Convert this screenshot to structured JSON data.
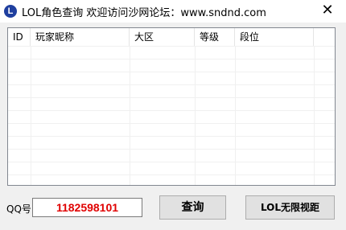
{
  "window": {
    "title": "LOL角色查询  欢迎访问沙网论坛：www.sndnd.com",
    "app_icon_glyph": "L",
    "close_glyph": "✕"
  },
  "listview": {
    "columns": [
      "ID",
      "玩家昵称",
      "大区",
      "等级",
      "段位",
      ""
    ],
    "rows": []
  },
  "form": {
    "qq_label": "QQ号:",
    "qq_value": "1182598101",
    "query_button": "查询",
    "lol_button": "LOL无限视距"
  },
  "colors": {
    "qq_text": "#e00000",
    "icon_bg": "#1f3f9f"
  }
}
